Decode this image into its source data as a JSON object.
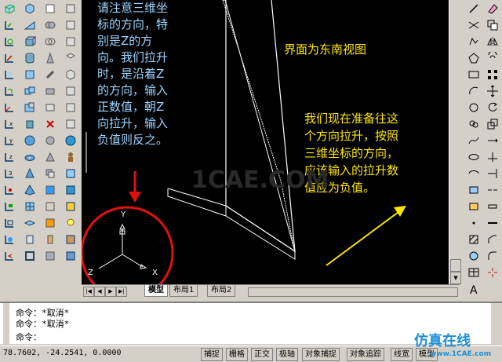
{
  "canvas": {
    "note_left": [
      "请注意三维坐",
      "标的方向，特",
      "别是Z的方",
      "向。我们拉升",
      "时，是沿着Z",
      "的方向，输入",
      "正数值，朝Z",
      "向拉升，输入",
      "负值则反之。"
    ],
    "note_title": "界面为东南视图",
    "note_right": [
      "我们现在准备往这",
      "个方向拉升，按照",
      "三维坐标的方向，",
      "应该输入的拉升数",
      "值应为负值。"
    ],
    "watermark": "1CAE.COM",
    "axis": {
      "y": "Y",
      "x": "X",
      "z": "Z"
    }
  },
  "tabs": {
    "model": "模型",
    "layout1": "布局1",
    "layout2": "布局2"
  },
  "command": {
    "lines": [
      "命令：*取消*",
      "命令：*取消*",
      "命令："
    ]
  },
  "status": {
    "coords": "78.7602,  -24.2541, 0.0000",
    "buttons": [
      "捕捉",
      "栅格",
      "正交",
      "极轴",
      "对象捕捉",
      "对象追踪",
      "线宽",
      "模型"
    ]
  },
  "logo": {
    "main": "仿真在线",
    "sub": "www.1CAE.com"
  },
  "colors": {
    "note_blue": "#9cd4ff",
    "note_yellow": "#ffe600",
    "circle": "#e01010"
  }
}
